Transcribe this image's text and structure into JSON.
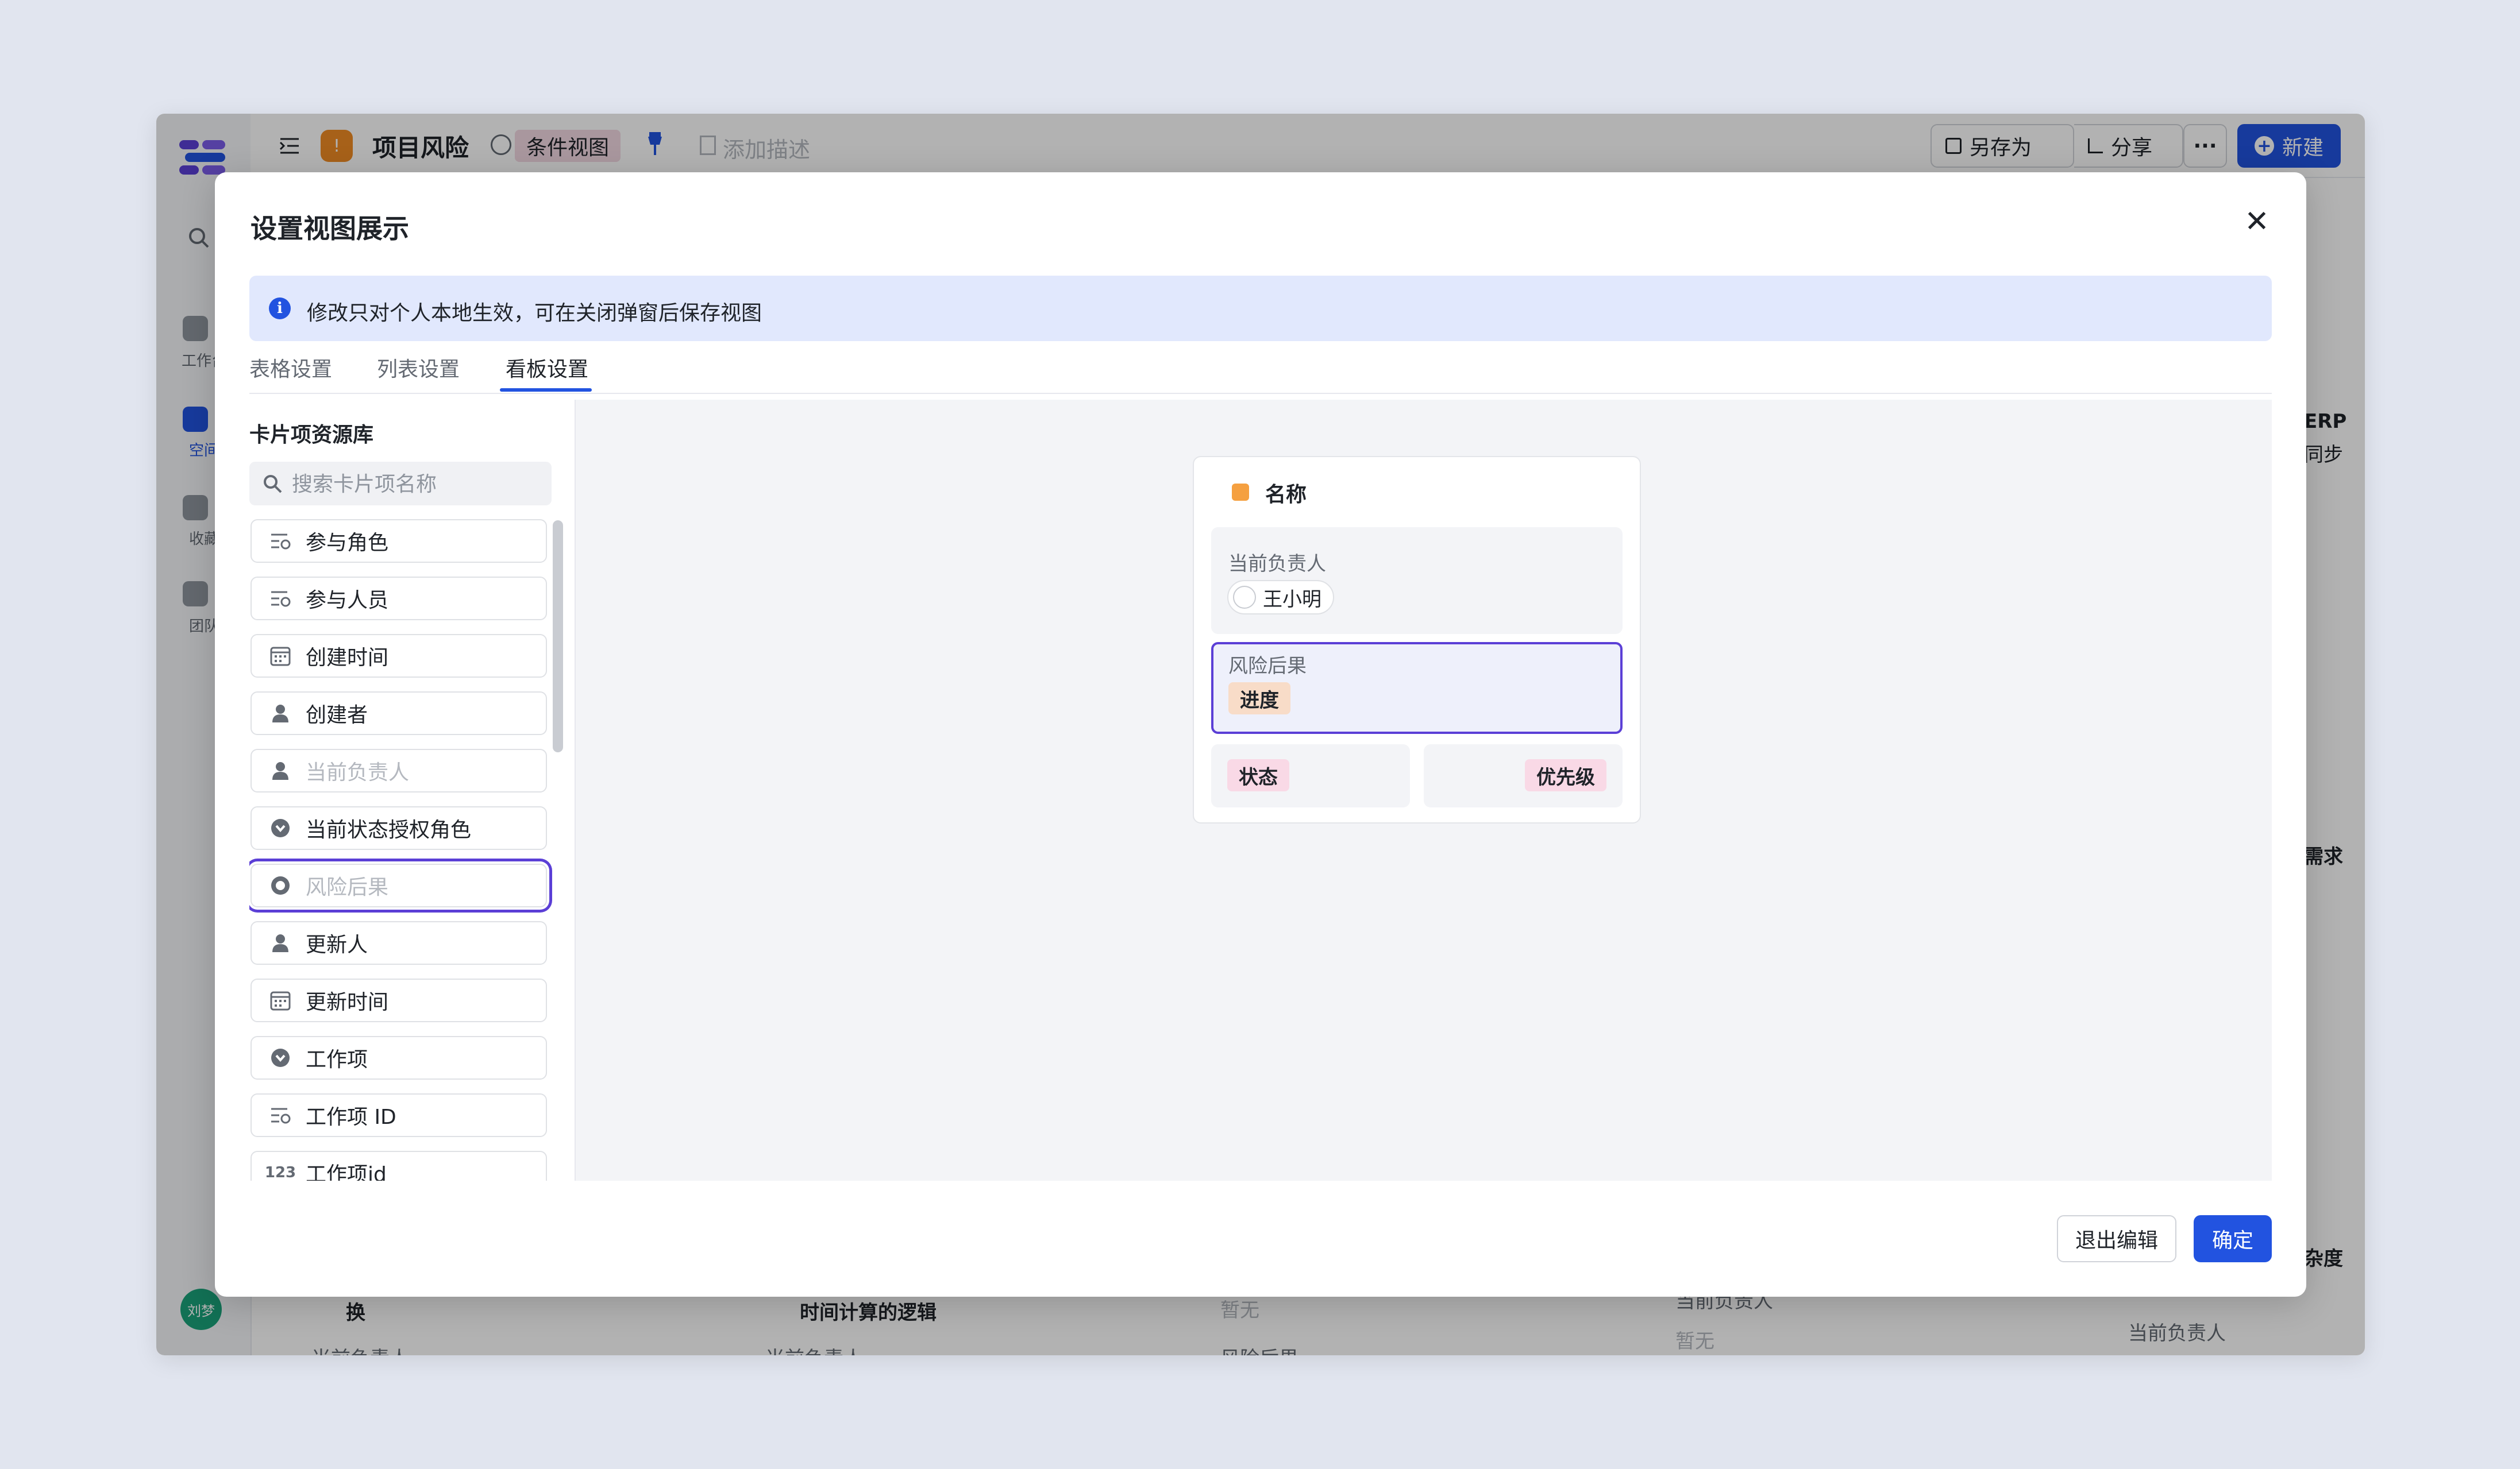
{
  "app": {
    "user_avatar_text": "刘梦",
    "sidebar": [
      {
        "label": "工作台",
        "icon": "home-icon"
      },
      {
        "label": "空间",
        "icon": "space-icon"
      },
      {
        "label": "收藏",
        "icon": "star-icon"
      },
      {
        "label": "团队",
        "icon": "team-icon"
      }
    ],
    "header": {
      "project_name": "项目风险",
      "view_name": "条件视图",
      "add_description": "添加描述",
      "save_as": "另存为",
      "share": "分享",
      "more": "···",
      "new": "新建"
    },
    "background_text": {
      "col_a_1": "换",
      "col_a_2": "当前负责人",
      "col_b_1": "时间计算的逻辑",
      "col_b_2": "当前负责人",
      "col_c_1": "暂无",
      "col_c_2": "风险后果",
      "col_d_1": "当前负责人",
      "col_d_2": "暂无",
      "col_e_1": "当前负责人",
      "right_1": "ERP",
      "right_2": "同步",
      "right_3": "需求",
      "right_4": "杂度"
    }
  },
  "modal": {
    "title": "设置视图展示",
    "notice": "修改只对个人本地生效，可在关闭弹窗后保存视图",
    "tabs": [
      {
        "label": "表格设置",
        "active": false
      },
      {
        "label": "列表设置",
        "active": false
      },
      {
        "label": "看板设置",
        "active": true
      }
    ],
    "library": {
      "title": "卡片项资源库",
      "search_placeholder": "搜索卡片项名称",
      "items": [
        {
          "label": "参与角色",
          "icon": "role-list-icon",
          "disabled": false
        },
        {
          "label": "参与人员",
          "icon": "role-list-icon",
          "disabled": false
        },
        {
          "label": "创建时间",
          "icon": "calendar-icon",
          "disabled": false
        },
        {
          "label": "创建者",
          "icon": "person-icon",
          "disabled": false
        },
        {
          "label": "当前负责人",
          "icon": "person-icon",
          "disabled": true
        },
        {
          "label": "当前状态授权角色",
          "icon": "dropdown-circle-icon",
          "disabled": false
        },
        {
          "label": "风险后果",
          "icon": "radio-circle-icon",
          "disabled": true,
          "highlighted": true
        },
        {
          "label": "更新人",
          "icon": "person-icon",
          "disabled": false
        },
        {
          "label": "更新时间",
          "icon": "calendar-icon",
          "disabled": false
        },
        {
          "label": "工作项",
          "icon": "dropdown-circle-icon",
          "disabled": false
        },
        {
          "label": "工作项 ID",
          "icon": "role-list-icon",
          "disabled": false
        },
        {
          "label": "工作项id",
          "icon": "number-icon",
          "icon_text": "123",
          "disabled": false
        }
      ]
    },
    "card_preview": {
      "title": "名称",
      "owner_label": "当前负责人",
      "owner_name": "王小明",
      "risk_label": "风险后果",
      "risk_chip": "进度",
      "status_chip": "状态",
      "priority_chip": "优先级"
    },
    "buttons": {
      "cancel": "退出编辑",
      "confirm": "确定"
    },
    "colors": {
      "accent": "#2253e0",
      "highlight": "#5b3fd6",
      "risk_chip_bg": "#f8dcc8",
      "status_chip_bg": "#f9d9e6",
      "priority_chip_bg": "#f9d9e6"
    }
  }
}
